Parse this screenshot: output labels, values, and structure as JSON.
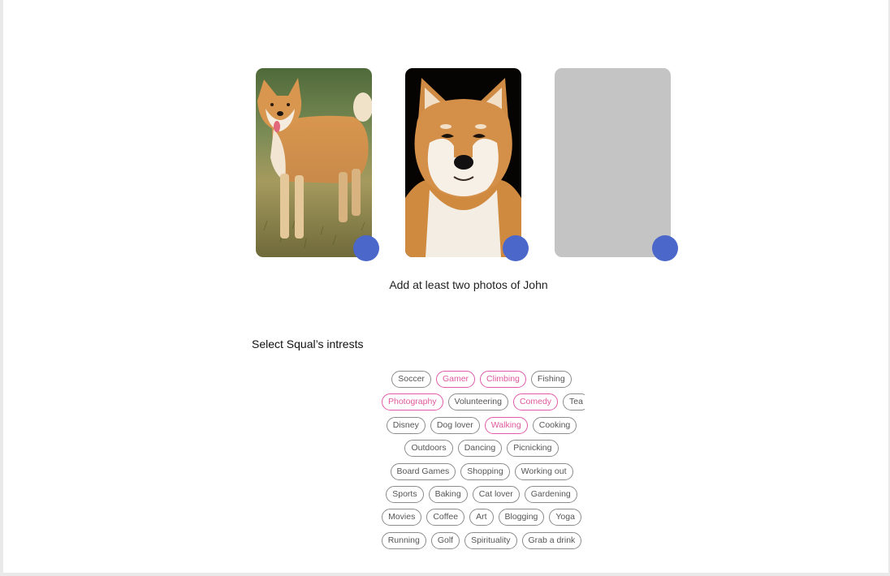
{
  "colors": {
    "accent": "#4a67c9",
    "selected_chip": "#e05aa7",
    "placeholder_card": "#c4c4c4"
  },
  "photos": [
    {
      "label": "photo slot 1",
      "image": "shiba inu standing on grass",
      "filled": true
    },
    {
      "label": "photo slot 2",
      "image": "shiba inu portrait on black background",
      "filled": true
    },
    {
      "label": "photo slot 3",
      "image": "",
      "filled": false
    }
  ],
  "hint_text": "Add  at least two photos of John",
  "interests_title": "Select Squal’s intrests",
  "interests": [
    [
      {
        "label": "Soccer",
        "selected": false
      },
      {
        "label": "Gamer",
        "selected": true
      },
      {
        "label": "Climbing",
        "selected": true
      },
      {
        "label": "Fishing",
        "selected": false
      }
    ],
    [
      {
        "label": "Photography",
        "selected": true
      },
      {
        "label": "Volunteering",
        "selected": false
      },
      {
        "label": "Comedy",
        "selected": true
      },
      {
        "label": "Tea",
        "selected": false
      }
    ],
    [
      {
        "label": "Disney",
        "selected": false
      },
      {
        "label": "Dog lover",
        "selected": false
      },
      {
        "label": "Walking",
        "selected": true
      },
      {
        "label": "Cooking",
        "selected": false
      }
    ],
    [
      {
        "label": "Outdoors",
        "selected": false
      },
      {
        "label": "Dancing",
        "selected": false
      },
      {
        "label": "Picnicking",
        "selected": false
      }
    ],
    [
      {
        "label": "Board Games",
        "selected": false
      },
      {
        "label": "Shopping",
        "selected": false
      },
      {
        "label": "Working out",
        "selected": false
      }
    ],
    [
      {
        "label": "Sports",
        "selected": false
      },
      {
        "label": "Baking",
        "selected": false
      },
      {
        "label": "Cat lover",
        "selected": false
      },
      {
        "label": "Gardening",
        "selected": false
      }
    ],
    [
      {
        "label": "Movies",
        "selected": false
      },
      {
        "label": "Coffee",
        "selected": false
      },
      {
        "label": "Art",
        "selected": false
      },
      {
        "label": "Blogging",
        "selected": false
      },
      {
        "label": "Yoga",
        "selected": false
      }
    ],
    [
      {
        "label": "Running",
        "selected": false
      },
      {
        "label": "Golf",
        "selected": false
      },
      {
        "label": "Spirituality",
        "selected": false
      },
      {
        "label": "Grab a drink",
        "selected": false
      }
    ]
  ]
}
